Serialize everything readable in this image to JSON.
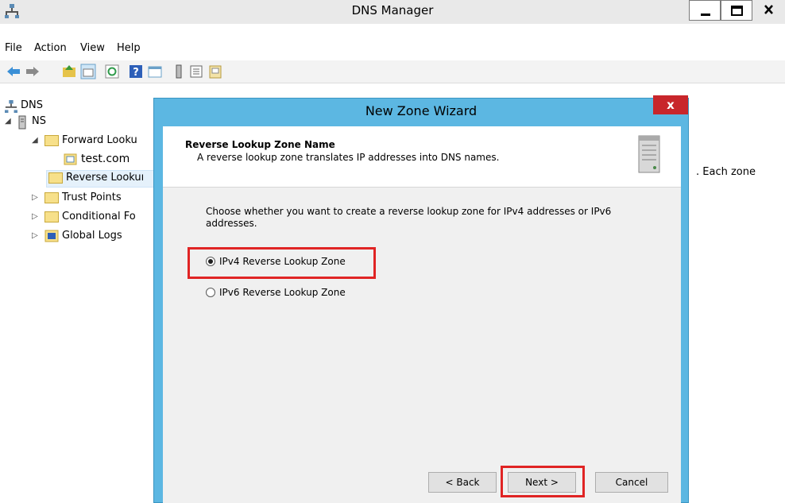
{
  "window": {
    "title": "DNS Manager"
  },
  "menu": [
    "File",
    "Action",
    "View",
    "Help"
  ],
  "toolbar_icons": [
    "back-arrow-icon",
    "forward-arrow-icon",
    "folder-up-icon",
    "console-tree-icon",
    "refresh-icon",
    "help-icon",
    "properties-icon",
    "server-icon",
    "list-icon",
    "export-icon"
  ],
  "tree": {
    "root": "DNS",
    "server": "NS",
    "forward": "Forward Looku",
    "forward_child": "test.com",
    "reverse": "Reverse Lookuı",
    "trust": "Trust Points",
    "conditional": "Conditional Fo",
    "global_logs": "Global Logs"
  },
  "right_panel_text": ". Each zone",
  "wizard": {
    "title": "New Zone Wizard",
    "close": "x",
    "header_title": "Reverse Lookup Zone Name",
    "header_desc": "A reverse lookup zone translates IP addresses into DNS names.",
    "prompt": "Choose whether you want to create a reverse lookup zone for IPv4 addresses or IPv6 addresses.",
    "options": [
      {
        "label": "IPv4 Reverse Lookup Zone",
        "checked": true
      },
      {
        "label": "IPv6 Reverse Lookup Zone",
        "checked": false
      }
    ],
    "buttons": {
      "back": "< Back",
      "next": "Next >",
      "cancel": "Cancel"
    }
  },
  "colors": {
    "dialog_border": "#5cb7e2",
    "highlight": "#e02424",
    "close_button": "#c8262b"
  }
}
